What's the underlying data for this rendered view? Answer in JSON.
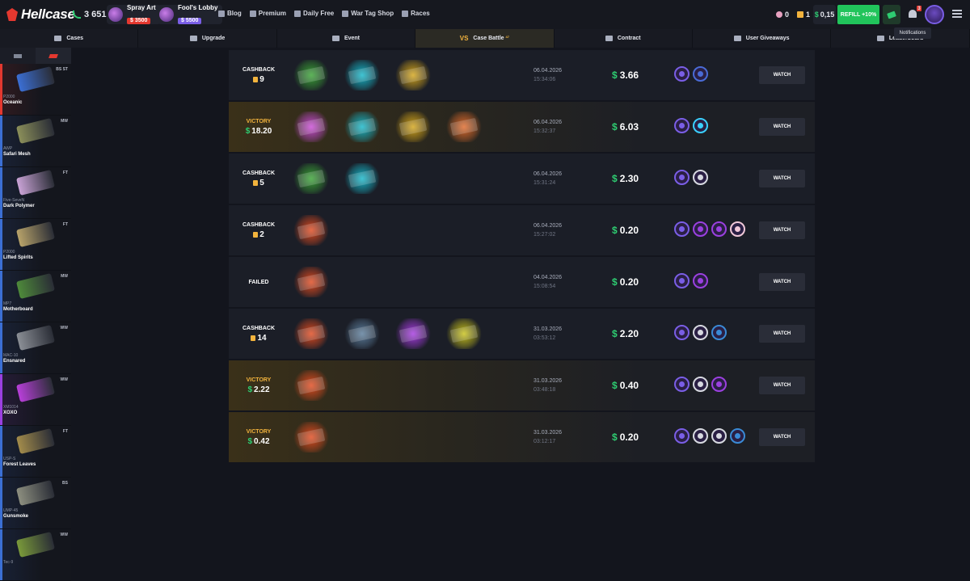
{
  "header": {
    "logo": "Hellcase",
    "online": "3 651",
    "promos": [
      {
        "name": "Spray Art",
        "price": "$ 3500",
        "color": "#e4382f"
      },
      {
        "name": "Fool's Lobby",
        "price": "$ 5500",
        "color": "#7a5ee6"
      }
    ],
    "nav": [
      "Blog",
      "Premium",
      "Daily Free",
      "War Tag Shop",
      "Races"
    ],
    "gems": "0",
    "tickets": "1",
    "balance": "0,15",
    "currency": "$",
    "refill_label": "REFILL +10%",
    "notification_count": "3",
    "tooltip": "Notifications"
  },
  "tabs": [
    {
      "label": "Cases",
      "icon": "cases-icon"
    },
    {
      "label": "Upgrade",
      "icon": "upgrade-icon"
    },
    {
      "label": "Event",
      "icon": "event-icon"
    },
    {
      "label": "Case Battle",
      "icon": "versus-icon",
      "active": true,
      "sup": "47"
    },
    {
      "label": "Contract",
      "icon": "contract-icon"
    },
    {
      "label": "User Giveaways",
      "icon": "giveaway-icon"
    },
    {
      "label": "Leaderboard",
      "icon": "leaderboard-icon"
    }
  ],
  "drops": [
    {
      "type": "P2000",
      "name": "Oceanic",
      "wear": "BS ST",
      "color": "#3b6fd4",
      "bar": "#e4382f"
    },
    {
      "type": "AWP",
      "name": "Safari Mesh",
      "wear": "MW",
      "color": "#8b8f5a",
      "bar": "#3b6fd4"
    },
    {
      "type": "Five-SeveN",
      "name": "Dark Polymer",
      "wear": "FT",
      "color": "#c9a3d6",
      "bar": "#3b6fd4"
    },
    {
      "type": "P2000",
      "name": "Lifted Spirits",
      "wear": "FT",
      "color": "#b8a36a",
      "bar": "#3b6fd4"
    },
    {
      "type": "MP7",
      "name": "Motherboard",
      "wear": "MW",
      "color": "#4e8a3a",
      "bar": "#3b6fd4"
    },
    {
      "type": "MAC-10",
      "name": "Ensnared",
      "wear": "WW",
      "color": "#8b8f96",
      "bar": "#3b6fd4"
    },
    {
      "type": "XM1014",
      "name": "XOXO",
      "wear": "WW",
      "color": "#b83fd9",
      "bar": "#9b40e0"
    },
    {
      "type": "USP-S",
      "name": "Forest Leaves",
      "wear": "FT",
      "color": "#a38c4b",
      "bar": "#3b6fd4"
    },
    {
      "type": "UMP-45",
      "name": "Gunsmoke",
      "wear": "BS",
      "color": "#8d8f80",
      "bar": "#3b6fd4"
    },
    {
      "type": "Tec-9",
      "name": "",
      "wear": "WW",
      "color": "#7a9a3a",
      "bar": "#3b6fd4"
    }
  ],
  "battles": [
    {
      "result": "CASHBACK",
      "amount": "9",
      "kind": "coin",
      "cases": [
        "#3aa335",
        "#16b7c9",
        "#d4a51a"
      ],
      "date": "06.04.2026",
      "time": "15:34:06",
      "total": "3.66",
      "players": [
        "#7a5ee6",
        "#4a6bd6"
      ],
      "watch": "WATCH"
    },
    {
      "result": "VICTORY",
      "amount": "18.20",
      "kind": "cash",
      "cases": [
        "#c94bd6",
        "#16b7c9",
        "#d4a51a",
        "#e06a2b"
      ],
      "date": "06.04.2026",
      "time": "15:32:37",
      "total": "6.03",
      "players": [
        "#7a5ee6",
        "#3ad0ff"
      ],
      "watch": "WATCH"
    },
    {
      "result": "CASHBACK",
      "amount": "5",
      "kind": "coin",
      "cases": [
        "#3aa335",
        "#16b7c9"
      ],
      "date": "06.04.2026",
      "time": "15:31:24",
      "total": "2.30",
      "players": [
        "#7a5ee6",
        "#d7d9e0"
      ],
      "watch": "WATCH"
    },
    {
      "result": "CASHBACK",
      "amount": "2",
      "kind": "coin",
      "cases": [
        "#e04a1f"
      ],
      "date": "06.04.2026",
      "time": "15:27:02",
      "total": "0.20",
      "players": [
        "#7a5ee6",
        "#9b40e0",
        "#9b40e0",
        "#f0c8d8"
      ],
      "watch": "WATCH"
    },
    {
      "result": "FAILED",
      "amount": "",
      "kind": "none",
      "cases": [
        "#e04a1f"
      ],
      "date": "04.04.2026",
      "time": "15:08:54",
      "total": "0.20",
      "players": [
        "#7a5ee6",
        "#9b40e0"
      ],
      "watch": "WATCH"
    },
    {
      "result": "CASHBACK",
      "amount": "14",
      "kind": "coin",
      "cases": [
        "#e04a1f",
        "#5b7c9a",
        "#a63ae0",
        "#c9c21a"
      ],
      "date": "31.03.2026",
      "time": "03:53:12",
      "total": "2.20",
      "players": [
        "#7a5ee6",
        "#d7d9e0",
        "#3a8ad6"
      ],
      "watch": "WATCH"
    },
    {
      "result": "VICTORY",
      "amount": "2.22",
      "kind": "cash",
      "cases": [
        "#e04a1f"
      ],
      "date": "31.03.2026",
      "time": "03:48:18",
      "total": "0.40",
      "players": [
        "#7a5ee6",
        "#d7d9e0",
        "#9b40e0"
      ],
      "watch": "WATCH"
    },
    {
      "result": "VICTORY",
      "amount": "0.42",
      "kind": "cash",
      "cases": [
        "#e04a1f"
      ],
      "date": "31.03.2026",
      "time": "03:12:17",
      "total": "0.20",
      "players": [
        "#7a5ee6",
        "#d7d9e0",
        "#d7d9e0",
        "#3a8ad6"
      ],
      "watch": "WATCH"
    }
  ]
}
